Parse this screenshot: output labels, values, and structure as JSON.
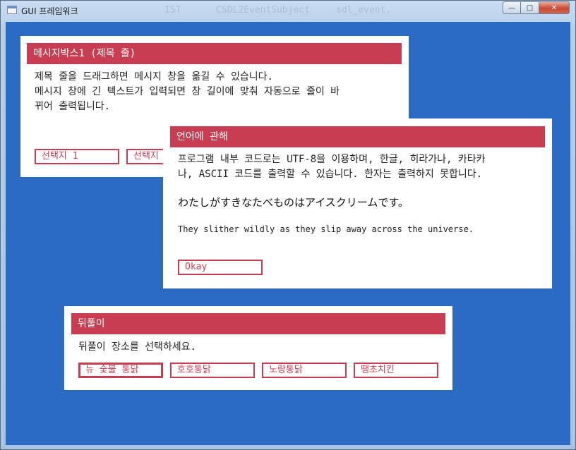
{
  "window": {
    "title": "GUI 프레임워크",
    "ghost_texts": [
      "IST",
      "CSDL2EventSubject",
      "sdl_event."
    ],
    "buttons": {
      "minimize": "—",
      "maximize": "□",
      "close": "✕"
    }
  },
  "colors": {
    "background": "#2b6bc4",
    "accent": "#c93d52",
    "dialog_bg": "#ffffff"
  },
  "dialog_message": {
    "title": "메시지박스1 (제목 줄)",
    "body": "제목 줄을 드래그하면 메시지 창을 옮길 수 있습니다.\n메시지 창에 긴 텍스트가 입력되면 창 길이에 맞춰 자동으로 줄이 바\n뀌어 출력됩니다.",
    "buttons": [
      "선택지 1",
      "선택지"
    ]
  },
  "dialog_language": {
    "title": "언어에 관해",
    "body": "프로그램 내부 코드로는 UTF-8을 이용하며, 한글, 히라가나, 카타카\n나, ASCII 코드를 출력할 수 있습니다. 한자는 출력하지 못합니다.",
    "japanese": "わたしがすきなたべものはアイスクリームです。",
    "english": "They slither wildly as they slip away across the universe.",
    "ok_button": "Okay"
  },
  "dialog_choice": {
    "title": "뒤풀이",
    "body": "뒤풀이 장소를 선택하세요.",
    "options": [
      "뉴 숯불 통닭",
      "호호통닭",
      "노랑통닭",
      "땡초치킨"
    ]
  }
}
